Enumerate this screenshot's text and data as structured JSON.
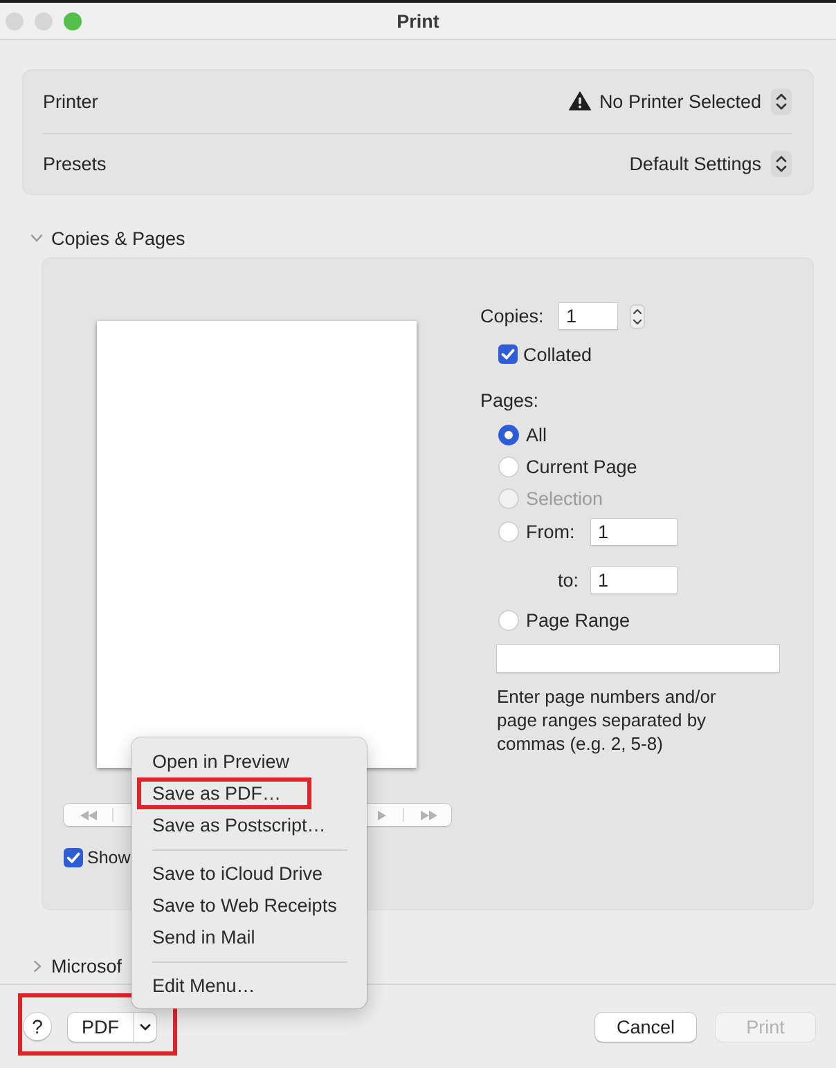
{
  "window": {
    "title": "Print",
    "controls": [
      {
        "kind": "close",
        "enabled": false
      },
      {
        "kind": "minimize",
        "enabled": false
      },
      {
        "kind": "zoom",
        "enabled": true
      }
    ]
  },
  "settings": [
    {
      "label": "Printer",
      "value": "No Printer Selected",
      "warning": true
    },
    {
      "label": "Presets",
      "value": "Default Settings",
      "warning": false
    }
  ],
  "copies_and_pages": {
    "title": "Copies & Pages",
    "expanded": true,
    "show_checkbox": {
      "label": "Show",
      "checked": true
    },
    "copies": {
      "label": "Copies:",
      "value": "1"
    },
    "collated": {
      "label": "Collated",
      "checked": true
    },
    "pages_label": "Pages:",
    "page_options": [
      {
        "kind": "radio",
        "label": "All",
        "selected": true,
        "disabled": false
      },
      {
        "kind": "radio",
        "label": "Current Page",
        "selected": false,
        "disabled": false
      },
      {
        "kind": "radio",
        "label": "Selection",
        "selected": false,
        "disabled": true
      },
      {
        "kind": "from_to",
        "label": "From:",
        "value": "1",
        "to_label": "to:",
        "to_value": "1",
        "selected": false,
        "disabled": false
      },
      {
        "kind": "range",
        "label": "Page Range",
        "hint": "Enter page numbers and/or page ranges separated by commas (e.g. 2, 5-8)",
        "selected": false,
        "disabled": false
      }
    ]
  },
  "next_section": {
    "title": "Microsof",
    "expanded": false
  },
  "output_menu": {
    "groups": [
      {
        "items": [
          {
            "label": "Open in Preview",
            "annotated": false
          },
          {
            "label": "Save as PDF…",
            "annotated": true
          },
          {
            "label": "Save as Postscript…",
            "annotated": false
          }
        ]
      },
      {
        "items": [
          {
            "label": "Save to iCloud Drive",
            "annotated": false
          },
          {
            "label": "Save to Web Receipts",
            "annotated": false
          },
          {
            "label": "Send in Mail",
            "annotated": false
          }
        ]
      },
      {
        "items": [
          {
            "label": "Edit Menu…",
            "annotated": false
          }
        ]
      }
    ]
  },
  "footer": {
    "help": "?",
    "pdf_button": "PDF",
    "annotated": true,
    "buttons": [
      {
        "label": "Cancel",
        "disabled": false
      },
      {
        "label": "Print",
        "disabled": true
      }
    ]
  }
}
